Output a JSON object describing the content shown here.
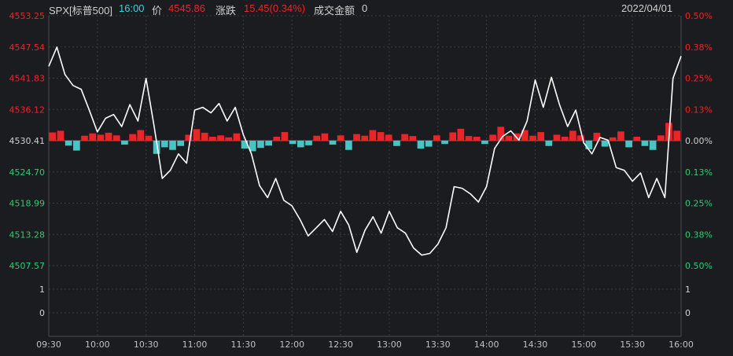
{
  "header": {
    "symbol": "SPX[标普500]",
    "time": "16:00",
    "price_label": "价",
    "price": "4545.86",
    "change_label": "涨跌",
    "change": "15.45(0.34%)",
    "amount_label": "成交金额",
    "amount": "0",
    "date": "2022/04/01"
  },
  "colors": {
    "background": "#1b1c20",
    "grid": "#3a3b40",
    "up": "#e8262a",
    "down": "#48c4c4",
    "line": "#ffffff",
    "neutral": "#d0d0d0",
    "cyan_text": "#3fd0e0"
  },
  "chart_data": [
    {
      "type": "line",
      "name": "price",
      "y_ticks_left": [
        "4553.25",
        "4547.54",
        "4541.83",
        "4536.12",
        "4530.41",
        "4524.70",
        "4518.99",
        "4513.28",
        "4507.57"
      ],
      "y_ticks_right": [
        "0.50%",
        "0.38%",
        "0.25%",
        "0.13%",
        "0.00%",
        "0.13%",
        "0.25%",
        "0.38%",
        "0.50%"
      ],
      "ylim": [
        4507.57,
        4553.25
      ],
      "baseline": 4530.41,
      "x_ticks": [
        "09:30",
        "10:00",
        "10:30",
        "11:00",
        "11:30",
        "12:00",
        "12:30",
        "13:00",
        "13:30",
        "14:00",
        "14:30",
        "15:00",
        "15:30",
        "16:00"
      ],
      "x": [
        "09:30",
        "09:35",
        "09:40",
        "09:45",
        "09:50",
        "09:55",
        "10:00",
        "10:05",
        "10:10",
        "10:15",
        "10:20",
        "10:25",
        "10:30",
        "10:35",
        "10:40",
        "10:45",
        "10:50",
        "10:55",
        "11:00",
        "11:05",
        "11:10",
        "11:15",
        "11:20",
        "11:25",
        "11:30",
        "11:35",
        "11:40",
        "11:45",
        "11:50",
        "11:55",
        "12:00",
        "12:05",
        "12:10",
        "12:15",
        "12:20",
        "12:25",
        "12:30",
        "12:35",
        "12:40",
        "12:45",
        "12:50",
        "12:55",
        "13:00",
        "13:05",
        "13:10",
        "13:15",
        "13:20",
        "13:25",
        "13:30",
        "13:35",
        "13:40",
        "13:45",
        "13:50",
        "13:55",
        "14:00",
        "14:05",
        "14:10",
        "14:15",
        "14:20",
        "14:25",
        "14:30",
        "14:35",
        "14:40",
        "14:45",
        "14:50",
        "14:55",
        "15:00",
        "15:05",
        "15:10",
        "15:15",
        "15:20",
        "15:25",
        "15:30",
        "15:35",
        "15:40",
        "15:45",
        "15:50",
        "15:55",
        "16:00"
      ],
      "values": [
        4544.0,
        4547.5,
        4542.5,
        4540.5,
        4539.8,
        4536.0,
        4532.0,
        4534.5,
        4535.2,
        4533.0,
        4537.0,
        4534.0,
        4541.8,
        4533.0,
        4523.5,
        4525.0,
        4528.0,
        4526.3,
        4536.0,
        4536.5,
        4535.5,
        4537.2,
        4534.0,
        4536.5,
        4531.5,
        4528.0,
        4522.2,
        4520.0,
        4523.5,
        4519.5,
        4518.5,
        4516.0,
        4513.0,
        4514.5,
        4516.0,
        4513.8,
        4517.5,
        4515.0,
        4510.0,
        4514.0,
        4516.5,
        4513.5,
        4517.5,
        4514.5,
        4513.5,
        4510.8,
        4509.5,
        4509.8,
        4511.5,
        4514.5,
        4522.0,
        4521.7,
        4520.7,
        4519.2,
        4522.0,
        4529.0,
        4531.2,
        4532.2,
        4530.5,
        4534.0,
        4541.5,
        4536.5,
        4542.0,
        4537.0,
        4533.0,
        4536.0,
        4530.0,
        4528.0,
        4531.0,
        4530.5,
        4525.5,
        4525.0,
        4523.0,
        4524.5,
        4520.0,
        4523.5,
        4520.0,
        4541.8,
        4545.86
      ]
    },
    {
      "type": "bar",
      "name": "advance-decline",
      "y_ticks_left": [
        "1",
        "0"
      ],
      "y_ticks_right": [
        "1",
        "0"
      ],
      "values": [
        2.5,
        3.0,
        -1.5,
        -3.0,
        1.5,
        2.2,
        1.8,
        2.4,
        1.6,
        -1.2,
        2.0,
        3.2,
        1.5,
        -4.0,
        -2.0,
        -2.8,
        -1.6,
        1.8,
        3.5,
        2.4,
        1.2,
        1.6,
        1.0,
        2.2,
        -2.4,
        -3.2,
        -2.2,
        -1.5,
        1.2,
        2.6,
        -1.0,
        -2.0,
        -1.4,
        1.5,
        2.2,
        -1.2,
        1.6,
        -2.8,
        2.0,
        1.5,
        3.2,
        2.6,
        1.8,
        -1.6,
        2.0,
        1.4,
        -2.4,
        -1.8,
        1.6,
        -1.0,
        2.5,
        3.6,
        1.4,
        1.2,
        -1.0,
        1.8,
        4.2,
        1.5,
        2.2,
        3.2,
        1.5,
        2.6,
        -1.6,
        1.8,
        1.2,
        3.0,
        1.6,
        -2.6,
        2.4,
        -1.8,
        1.0,
        2.8,
        -2.0,
        1.2,
        -1.6,
        -2.8,
        1.6,
        5.4,
        3.0
      ]
    }
  ]
}
